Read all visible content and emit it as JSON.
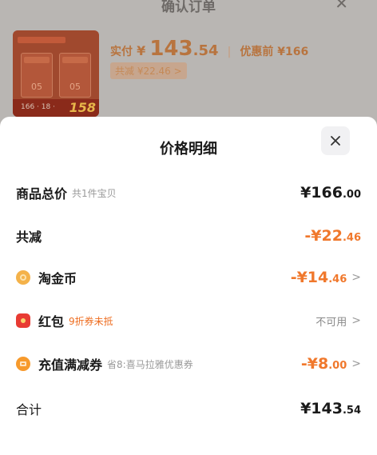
{
  "background": {
    "title": "确认订单",
    "paid_label": "实付",
    "paid_currency": "¥",
    "paid_int": "143",
    "paid_dec": ".54",
    "separator": "|",
    "orig_label": "优惠前 ¥166",
    "reduce_text": "共减 ¥22.46 >",
    "thumb_price": "158",
    "thumb_value": "166 · 18 ·"
  },
  "sheet": {
    "title": "价格明细",
    "rows": [
      {
        "label": "商品总价",
        "sub": "共1件宝贝",
        "amount_big": "¥166",
        "amount_small": ".00"
      },
      {
        "label": "共减",
        "amount_big": "-¥22",
        "amount_small": ".46"
      },
      {
        "label": "淘金币",
        "icon": "coin-icon",
        "amount_big": "-¥14",
        "amount_small": ".46",
        "chevron": ">"
      },
      {
        "label": "红包",
        "icon": "red-packet-icon",
        "sub": "9折券未抵",
        "value": "不可用",
        "chevron": ">"
      },
      {
        "label": "充值满减券",
        "icon": "top-up-icon",
        "sub": "省8:喜马拉雅优惠券",
        "amount_big": "-¥8",
        "amount_small": ".00",
        "chevron": ">"
      },
      {
        "label": "合计",
        "amount_big": "¥143",
        "amount_small": ".54"
      }
    ]
  },
  "colors": {
    "accent_orange": "#f0782c",
    "sub_orange": "#ee6d20",
    "text_dark": "#1a1a1a",
    "text_gray": "#999999"
  }
}
